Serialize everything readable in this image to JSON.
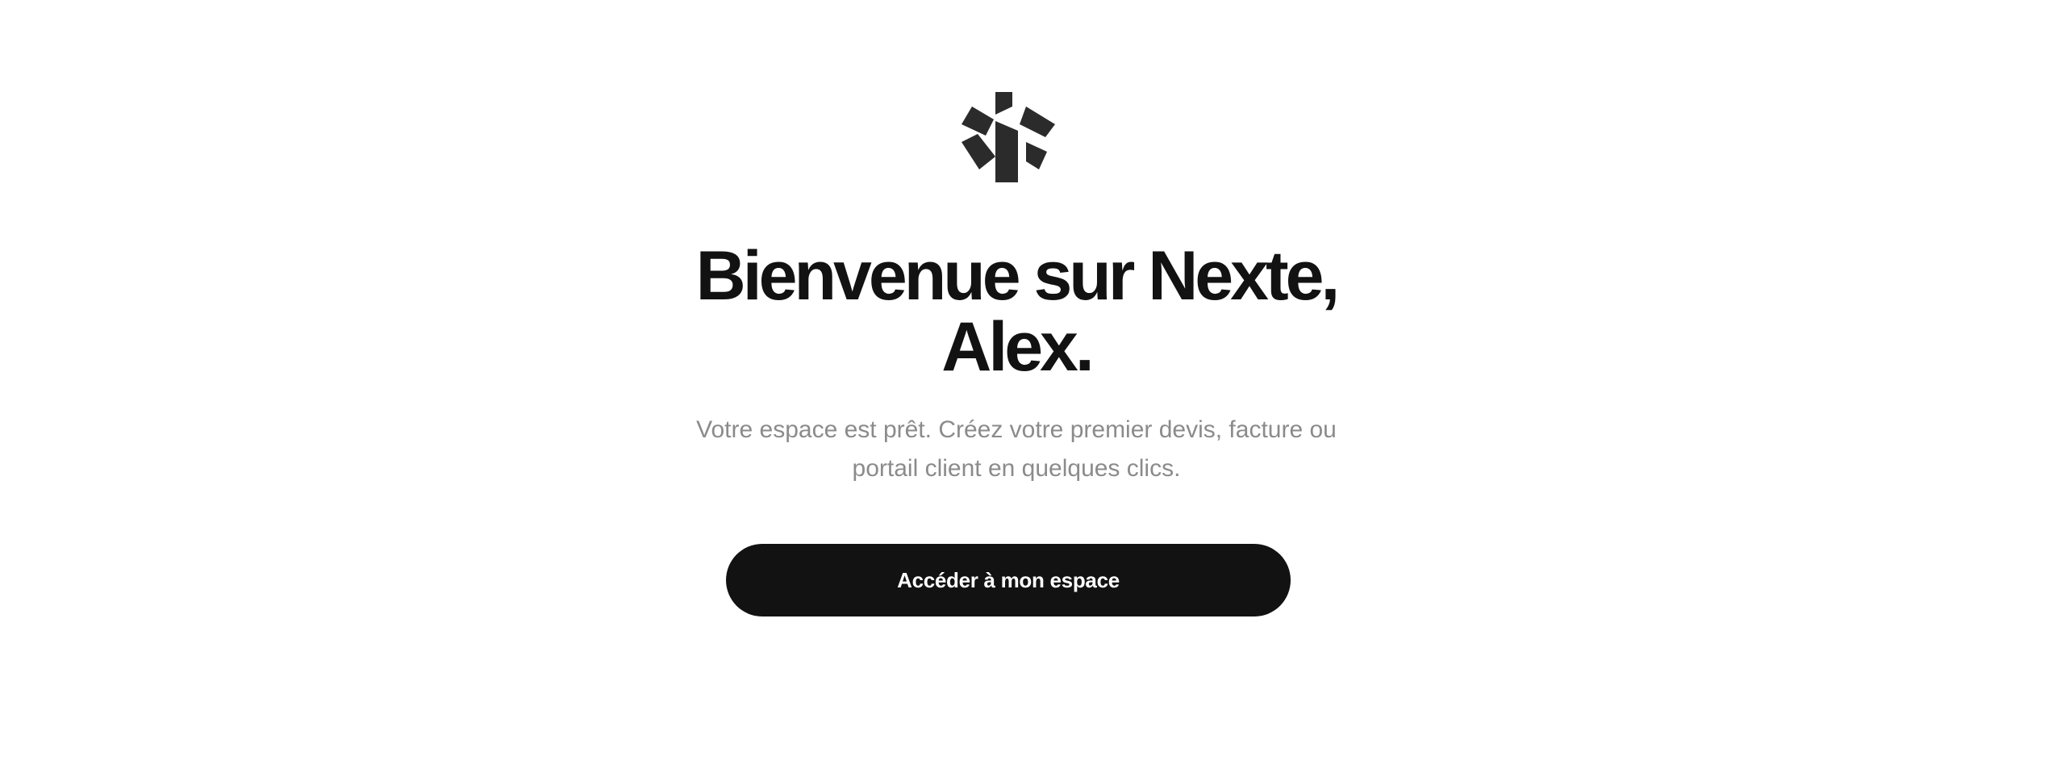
{
  "brand": {
    "logo_icon": "asterisk-logo-icon",
    "logo_color": "#2b2b2b"
  },
  "welcome": {
    "title_line1": "Bienvenue sur Nexte,",
    "title_line2": "Alex.",
    "subtitle_line1": "Votre espace est prêt. Créez votre premier devis, facture ou",
    "subtitle_line2": "portail client en quelques clics.",
    "cta_label": "Accéder à mon espace"
  },
  "colors": {
    "background": "#ffffff",
    "title": "#121212",
    "subtitle": "#8b8b8b",
    "button_background": "#121212",
    "button_text": "#ffffff"
  }
}
